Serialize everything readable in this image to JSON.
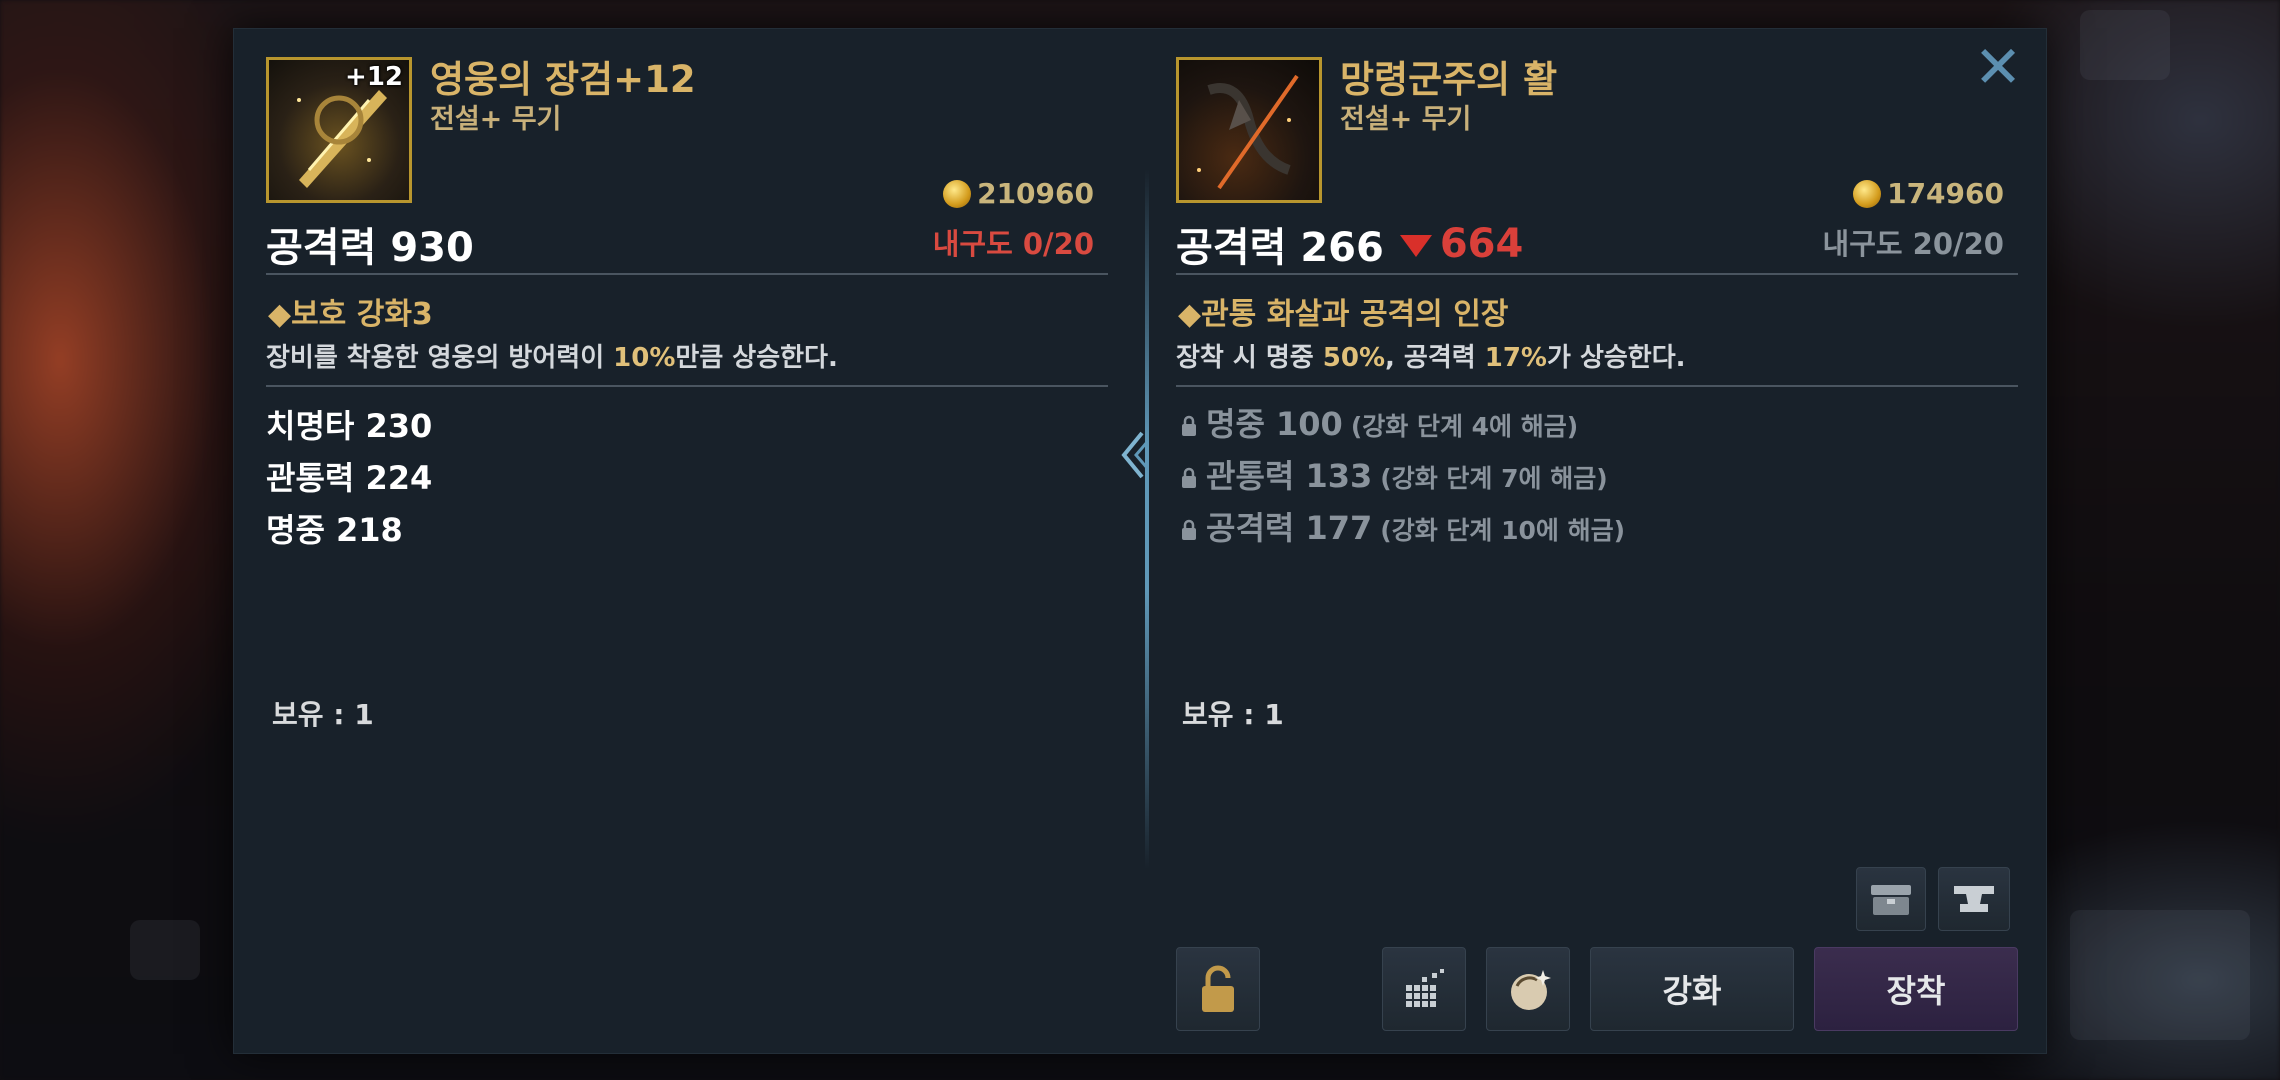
{
  "left_item": {
    "enhance_badge": "+12",
    "name": "영웅의 장검+12",
    "grade": "전설+ 무기",
    "price": "210960",
    "attack": "공격력 930",
    "durability": "내구도 0/20",
    "durability_color": "#d94a40",
    "skill_title": "◆보호 강화3",
    "skill_desc_parts": [
      "장비를 착용한 영웅의 방어력이 ",
      "10%",
      "만큼 상승한다."
    ],
    "stats": [
      "치명타 230",
      "관통력 224",
      "명중 218"
    ],
    "owned": "보유 : 1"
  },
  "right_item": {
    "name": "망령군주의 활",
    "grade": "전설+ 무기",
    "price": "174960",
    "attack": "공격력 266",
    "attack_diff": "664",
    "durability": "내구도 20/20",
    "durability_color": "#8b949c",
    "skill_title": "◆관통 화살과 공격의 인장",
    "skill_desc_parts": [
      "장착 시 명중 ",
      "50%",
      ", 공격력 ",
      "17%",
      "가 상승한다."
    ],
    "locked_stats": [
      {
        "stat": "명중 100",
        "note": "(강화 단계 4에 해금)"
      },
      {
        "stat": "관통력 133",
        "note": "(강화 단계 7에 해금)"
      },
      {
        "stat": "공격력 177",
        "note": "(강화 단계 10에 해금)"
      }
    ],
    "owned": "보유 : 1"
  },
  "buttons": {
    "enhance": "강화",
    "equip": "장착"
  },
  "icons": {
    "close": "close-icon",
    "coin": "gold-coin-icon",
    "lock": "lock-icon",
    "storage": "storage-chest-icon",
    "anvil": "anvil-icon",
    "grid": "dismantle-grid-icon",
    "gem": "gem-icon",
    "compare_arrow": "compare-arrow-icon"
  },
  "colors": {
    "item_name": "#d9b468",
    "decrease": "#d9403a",
    "equip_button": "#3b2d4e"
  }
}
